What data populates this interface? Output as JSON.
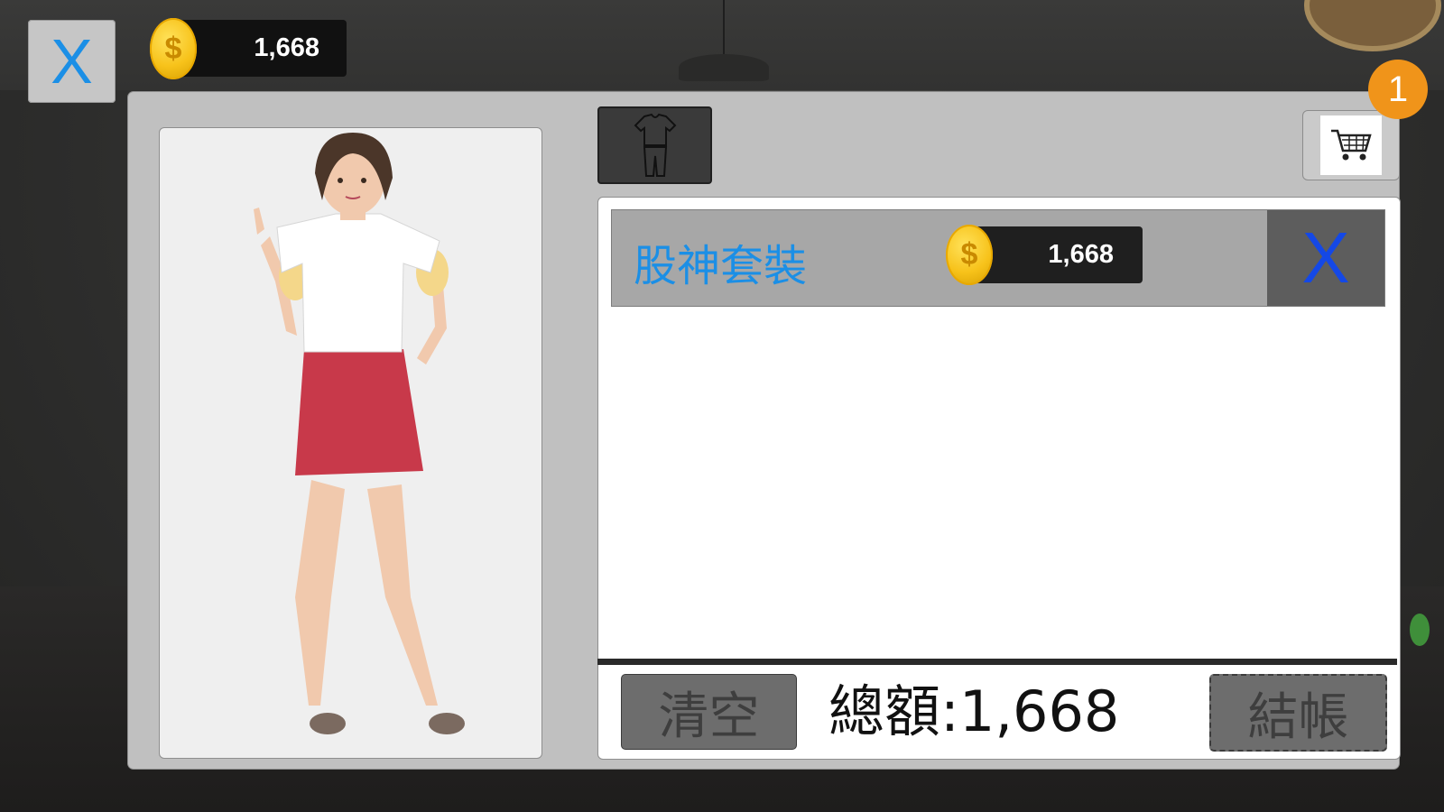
{
  "topbar": {
    "close_label": "X",
    "currency": "1,668",
    "coin_symbol": "$"
  },
  "tabs": {
    "outfit_icon": "outfit-icon"
  },
  "cart": {
    "badge_count": "1",
    "icon": "cart-icon"
  },
  "cart_items": [
    {
      "name": "股神套裝",
      "price": "1,668",
      "remove_label": "X"
    }
  ],
  "footer": {
    "clear_label": "清空",
    "total_label": "總額:1,668",
    "checkout_label": "結帳"
  },
  "colors": {
    "accent_blue": "#1b8fe6",
    "remove_blue": "#1448e6",
    "badge_orange": "#f0941a",
    "coin_gold": "#f7c21a"
  }
}
